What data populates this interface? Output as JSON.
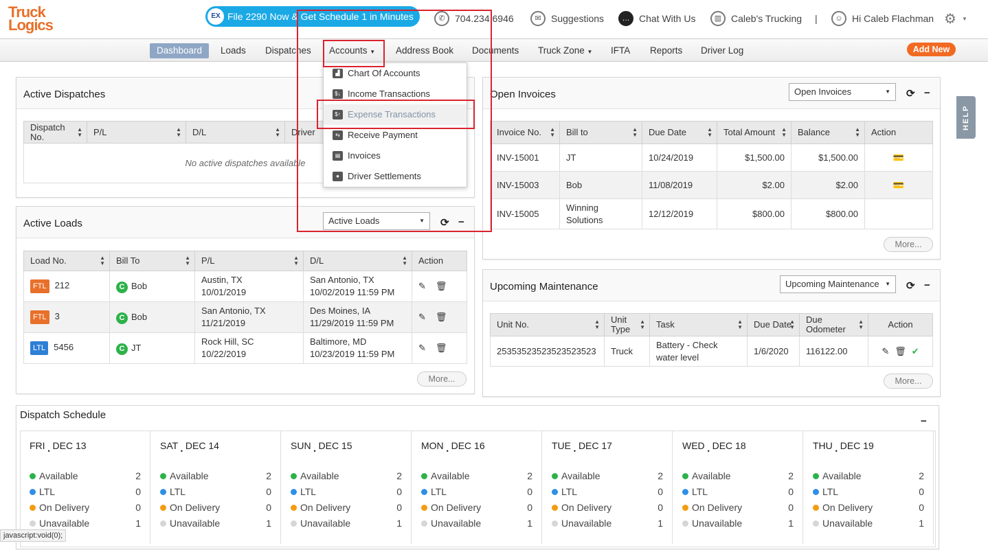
{
  "header": {
    "logo": "Truck Logics",
    "promo": "File 2290 Now & Get Schedule 1 in Minutes",
    "phone": "704.234.6946",
    "suggestions": "Suggestions",
    "chat": "Chat With Us",
    "company": "Caleb's Trucking",
    "separator": "|",
    "user": "Hi Caleb Flachman"
  },
  "nav": {
    "items": [
      "Dashboard",
      "Loads",
      "Dispatches",
      "Accounts",
      "Address Book",
      "Documents",
      "Truck Zone",
      "IFTA",
      "Reports",
      "Driver Log"
    ],
    "add_new": "Add New"
  },
  "accounts_menu": [
    {
      "label": "Chart Of Accounts",
      "icon": "chart-icon"
    },
    {
      "label": "Income Transactions",
      "icon": "income-icon"
    },
    {
      "label": "Expense Transactions",
      "icon": "expense-icon"
    },
    {
      "label": "Receive Payment",
      "icon": "payment-icon"
    },
    {
      "label": "Invoices",
      "icon": "invoice-icon"
    },
    {
      "label": "Driver Settlements",
      "icon": "driver-icon"
    }
  ],
  "active_dispatches": {
    "title": "Active Dispatches",
    "columns": [
      "Dispatch No.",
      "P/L",
      "D/L",
      "Driver"
    ],
    "empty": "No active dispatches available"
  },
  "active_loads": {
    "title": "Active Loads",
    "filter": "Active Loads",
    "columns": [
      "Load No.",
      "Bill To",
      "P/L",
      "D/L",
      "Action"
    ],
    "rows": [
      {
        "type": "FTL",
        "no": "212",
        "bill": "Bob",
        "pl1": "Austin, TX",
        "pl2": "10/01/2019",
        "dl1": "San Antonio, TX",
        "dl2": "10/02/2019 11:59 PM"
      },
      {
        "type": "FTL",
        "no": "3",
        "bill": "Bob",
        "pl1": "San Antonio, TX",
        "pl2": "11/21/2019",
        "dl1": "Des Moines, IA",
        "dl2": "11/29/2019 11:59 PM"
      },
      {
        "type": "LTL",
        "no": "5456",
        "bill": "JT",
        "pl1": "Rock Hill, SC",
        "pl2": "10/22/2019",
        "dl1": "Baltimore, MD",
        "dl2": "10/23/2019 11:59 PM"
      }
    ],
    "more": "More...",
    "customer_badge": "C"
  },
  "open_invoices": {
    "title": "Open Invoices",
    "filter": "Open Invoices",
    "columns": [
      "Invoice No.",
      "Bill to",
      "Due Date",
      "Total Amount",
      "Balance",
      "Action"
    ],
    "rows": [
      [
        "INV-15001",
        "JT",
        "10/24/2019",
        "$1,500.00",
        "$1,500.00"
      ],
      [
        "INV-15003",
        "Bob",
        "11/08/2019",
        "$2.00",
        "$2.00"
      ],
      [
        "INV-15005",
        "Winning Solutions",
        "12/12/2019",
        "$800.00",
        "$800.00"
      ]
    ],
    "more": "More..."
  },
  "maintenance": {
    "title": "Upcoming Maintenance",
    "filter": "Upcoming Maintenance",
    "columns": [
      "Unit No.",
      "Unit Type",
      "Task",
      "Due Date",
      "Due Odometer",
      "Action"
    ],
    "rows": [
      [
        "25353523523523523523",
        "Truck",
        "Battery - Check water level",
        "1/6/2020",
        "116122.00"
      ]
    ],
    "more": "More..."
  },
  "schedule": {
    "title": "Dispatch Schedule",
    "status_labels": [
      "Available",
      "LTL",
      "On Delivery",
      "Unavailable"
    ],
    "status_colors": [
      "#2db24a",
      "#2e8fe6",
      "#f39c12",
      "#d6d6d6"
    ],
    "days": [
      {
        "d": "FRI",
        "date": "DEC 13",
        "v": [
          "2",
          "0",
          "0",
          "1"
        ]
      },
      {
        "d": "SAT",
        "date": "DEC 14",
        "v": [
          "2",
          "0",
          "0",
          "1"
        ]
      },
      {
        "d": "SUN",
        "date": "DEC 15",
        "v": [
          "2",
          "0",
          "0",
          "1"
        ]
      },
      {
        "d": "MON",
        "date": "DEC 16",
        "v": [
          "2",
          "0",
          "0",
          "1"
        ]
      },
      {
        "d": "TUE",
        "date": "DEC 17",
        "v": [
          "2",
          "0",
          "0",
          "1"
        ]
      },
      {
        "d": "WED",
        "date": "DEC 18",
        "v": [
          "2",
          "0",
          "0",
          "1"
        ]
      },
      {
        "d": "THU",
        "date": "DEC 19",
        "v": [
          "2",
          "0",
          "0",
          "1"
        ]
      }
    ]
  },
  "help": "HELP",
  "statusbar": "javascript:void(0);",
  "colors": {
    "accent": "#f26a22",
    "promo": "#1ba9e6",
    "nav_active": "#8fa6c4",
    "ftl": "#e8702a",
    "ltl": "#2e7fd6",
    "highlight": "#d9232d"
  }
}
